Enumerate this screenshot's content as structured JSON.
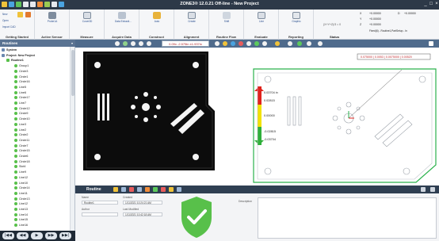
{
  "window": {
    "title": "ZONE3® 12.0.21 Off-line - New Project",
    "minimize": "_",
    "maximize": "□",
    "close": "×"
  },
  "ribbon": {
    "groups": [
      {
        "label": "Getting Started",
        "items": [
          "New",
          "Open",
          "Import CAD"
        ]
      },
      {
        "label": "Active Sensor",
        "items": [
          "Probe1A"
        ]
      },
      {
        "label": "Measure",
        "items": [
          "Curve3D"
        ]
      },
      {
        "label": "Acquire Data",
        "items": [
          "Data Extracti..."
        ]
      },
      {
        "label": "Construct",
        "items": [
          "Auto"
        ]
      },
      {
        "label": "Alignment",
        "items": [
          "Create"
        ]
      },
      {
        "label": "Routine Flow",
        "items": [
          "Shift"
        ]
      },
      {
        "label": "Evaluate",
        "items": [
          "Line"
        ]
      },
      {
        "label": "Reporting",
        "items": [
          "Graphic"
        ]
      }
    ],
    "status": {
      "label": "Status",
      "x_label": "X",
      "x_value": "+0.00000",
      "x_delta_label": "D",
      "x_delta": "+0.00000",
      "y_label": "Y",
      "y_value": "+0.00000",
      "z_label": "Z",
      "z_value": "+0.00000",
      "equation": "(X+Y+Z)/3 = 0",
      "info": "Fixed(6) - Routine1,PartSetup - In"
    }
  },
  "routines_panel": {
    "title": "Routines",
    "tree": [
      {
        "label": "System",
        "level": 0
      },
      {
        "label": "Project: New Project",
        "level": 0
      },
      {
        "label": "Routine1",
        "level": 1
      },
      {
        "label": "Group1",
        "level": 2
      },
      {
        "label": "Circle3",
        "level": 2
      },
      {
        "label": "Circle1",
        "level": 2
      },
      {
        "label": "Circle16",
        "level": 2
      },
      {
        "label": "Line5",
        "level": 2
      },
      {
        "label": "Line6",
        "level": 2
      },
      {
        "label": "Circle17",
        "level": 2
      },
      {
        "label": "Line7",
        "level": 2
      },
      {
        "label": "Circle12",
        "level": 2
      },
      {
        "label": "Circle9",
        "level": 2
      },
      {
        "label": "Circle10",
        "level": 2
      },
      {
        "label": "Line3",
        "level": 2
      },
      {
        "label": "Line2",
        "level": 2
      },
      {
        "label": "Circle2",
        "level": 2
      },
      {
        "label": "Circle11",
        "level": 2
      },
      {
        "label": "Circle7",
        "level": 2
      },
      {
        "label": "Circle15",
        "level": 2
      },
      {
        "label": "Circle6",
        "level": 2
      },
      {
        "label": "Circle18",
        "level": 2
      },
      {
        "label": "Slot4",
        "level": 2
      },
      {
        "label": "Line9",
        "level": 2
      },
      {
        "label": "Line12",
        "level": 2
      },
      {
        "label": "Line10",
        "level": 2
      },
      {
        "label": "Circle14",
        "level": 2
      },
      {
        "label": "Line11",
        "level": 2
      },
      {
        "label": "Circle13",
        "level": 2
      },
      {
        "label": "Line12",
        "level": 2
      },
      {
        "label": "Line13",
        "level": 2
      },
      {
        "label": "Line14",
        "level": 2
      },
      {
        "label": "Line15",
        "level": 2
      },
      {
        "label": "Line16",
        "level": 2
      }
    ]
  },
  "viewport": {
    "coordinates": "0.09x -2.575in ±1.937in",
    "feature_label": "0.075000 | 0.0053 | 0.0075000 | 0.00520",
    "scale": {
      "values": [
        "0.03704 in",
        "0.02815",
        "0.00000",
        "-0.02815",
        "-0.03704"
      ]
    },
    "colors": {
      "scale_red": "#e0231c",
      "scale_yellow": "#f2e200",
      "scale_green": "#2faf3a",
      "part_outline": "#2bb24c"
    }
  },
  "bottom_panel": {
    "title": "Routine",
    "fields": {
      "name_label": "Name",
      "name_value": "Routine1",
      "created_label": "Created",
      "created_value": "1/11/2021 10:24:21 AM",
      "author_label": "Author",
      "author_value": "",
      "modified_label": "Last Modified",
      "modified_value": "1/11/2021 10:42:18 AM",
      "description_label": "Description"
    },
    "status_color": "#58c04a"
  },
  "playback": {
    "first": "|◀◀",
    "prev": "◀◀",
    "play": "▶",
    "next": "▶▶",
    "last": "▶▶|"
  }
}
